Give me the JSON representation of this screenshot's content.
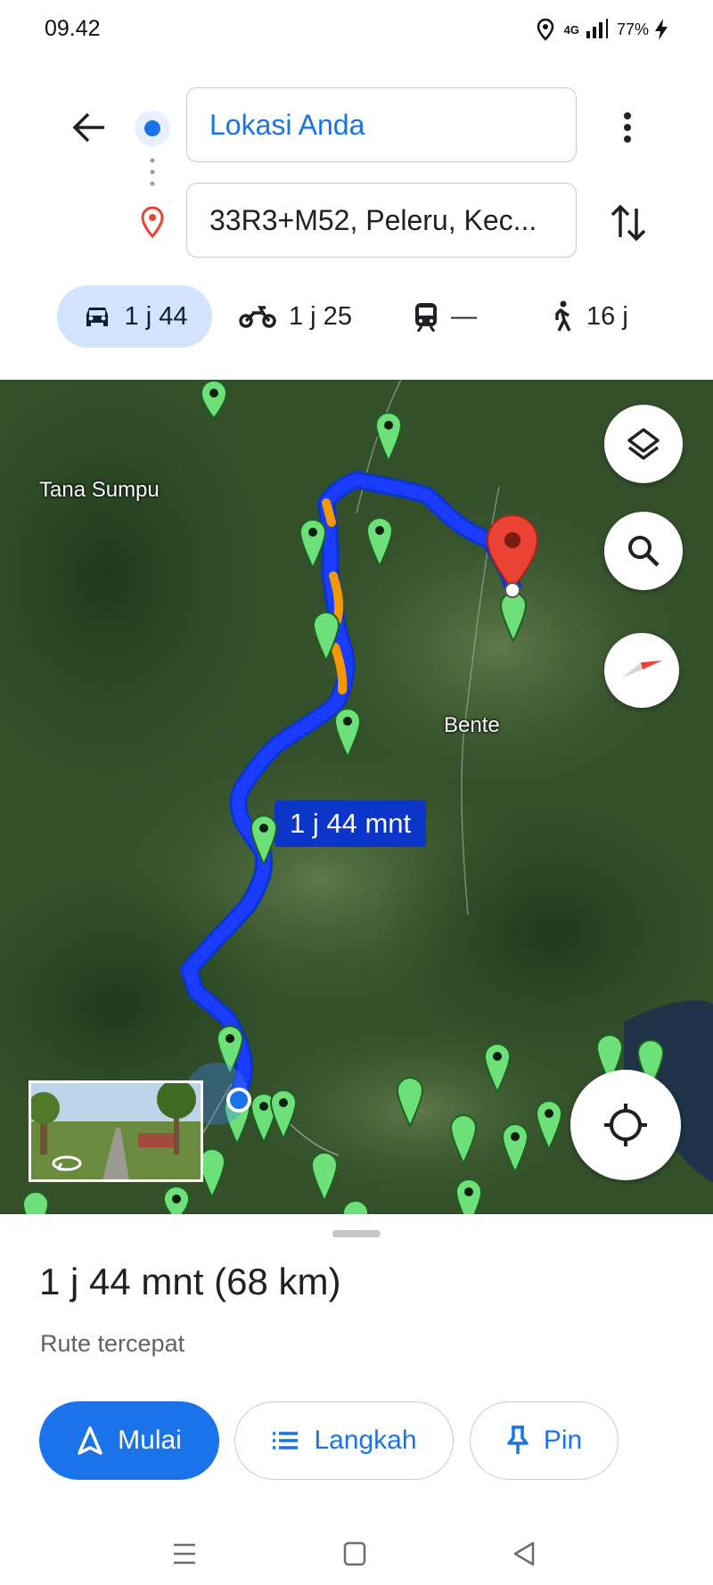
{
  "status_bar": {
    "time": "09.42",
    "network": "4G",
    "battery": "77%",
    "icons": [
      "location-icon",
      "signal-icon",
      "battery-charging-icon"
    ]
  },
  "directions": {
    "origin": "Lokasi Anda",
    "destination": "33R3+M52, Peleru, Kec...",
    "modes": [
      {
        "name": "car",
        "label": "1 j 44",
        "selected": true
      },
      {
        "name": "motorcycle",
        "label": "1 j 25"
      },
      {
        "name": "transit",
        "label": "—"
      },
      {
        "name": "walking",
        "label": "16 j"
      }
    ]
  },
  "map": {
    "labels": {
      "place1": "Tana Sumpu",
      "place2": "Bente"
    },
    "route_duration": "1 j 44 mnt",
    "route_color": "#1a3cff",
    "traffic_color": "#f29900"
  },
  "sheet": {
    "summary": "1 j 44 mnt (68 km)",
    "subtitle": "Rute tercepat",
    "start_label": "Mulai",
    "steps_label": "Langkah",
    "pin_label": "Pin"
  },
  "colors": {
    "accent": "#1a73e8",
    "destination_pin": "#ea4335"
  }
}
